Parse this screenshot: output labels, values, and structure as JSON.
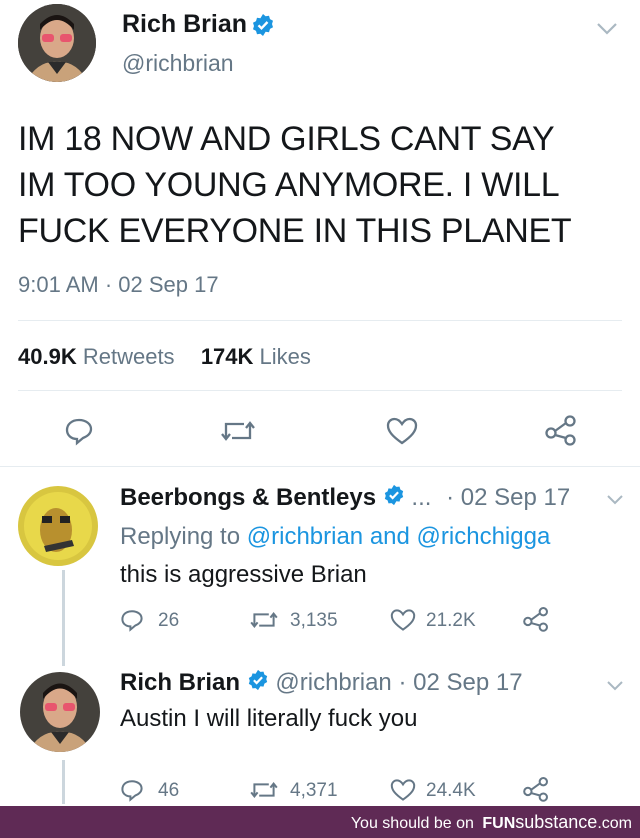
{
  "main_tweet": {
    "name": "Rich Brian",
    "handle": "@richbrian",
    "text_lines": [
      "IM 18 NOW AND GIRLS CANT SAY",
      "IM TOO YOUNG ANYMORE. I WILL",
      "FUCK EVERYONE IN THIS PLANET"
    ],
    "timestamp": "9:01 AM · 02 Sep 17",
    "retweets_count": "40.9K",
    "retweets_label": "Retweets",
    "likes_count": "174K",
    "likes_label": "Likes"
  },
  "reply1": {
    "name": "Beerbongs & Bentleys",
    "ellipsis": "...",
    "date": "· 02 Sep 17",
    "replying_prefix": "Replying to",
    "replying_to": "@richbrian and @richchigga",
    "text": "this is aggressive Brian",
    "replies": "26",
    "retweets": "3,135",
    "likes": "21.2K"
  },
  "reply2": {
    "name": "Rich Brian",
    "handle_date": "@richbrian · 02 Sep 17",
    "text": "Austin I will literally fuck you",
    "replies": "46",
    "retweets": "4,371",
    "likes": "24.4K"
  },
  "footer": {
    "text": "You should be on",
    "brand_fun": "FUN",
    "brand_rest": "substance",
    "brand_tld": ".com"
  },
  "colors": {
    "accent": "#1b95e0",
    "muted": "#657786",
    "footer_bg": "#5f2a55"
  }
}
